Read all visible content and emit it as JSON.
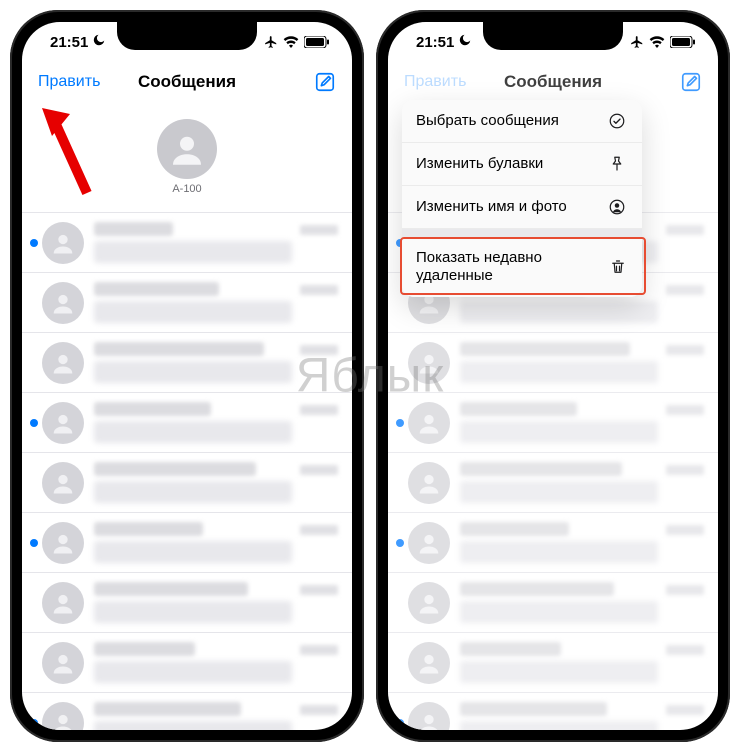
{
  "watermark": "Яблык",
  "status": {
    "time": "21:51"
  },
  "nav": {
    "edit": "Править",
    "title": "Сообщения"
  },
  "pinned": {
    "name": "A-100"
  },
  "menu": {
    "select_messages": "Выбрать сообщения",
    "edit_pins": "Изменить булавки",
    "edit_name_photo": "Изменить имя и фото",
    "show_recently_deleted": "Показать недавно удаленные"
  },
  "rows_left": [
    {
      "unread": true
    },
    {
      "unread": false
    },
    {
      "unread": false
    },
    {
      "unread": true
    },
    {
      "unread": false
    },
    {
      "unread": true
    },
    {
      "unread": false
    },
    {
      "unread": false
    },
    {
      "unread": true
    }
  ],
  "rows_right": [
    {
      "unread": true
    },
    {
      "unread": false
    },
    {
      "unread": false
    },
    {
      "unread": true
    },
    {
      "unread": false
    },
    {
      "unread": true
    },
    {
      "unread": false
    },
    {
      "unread": false
    },
    {
      "unread": true
    }
  ]
}
